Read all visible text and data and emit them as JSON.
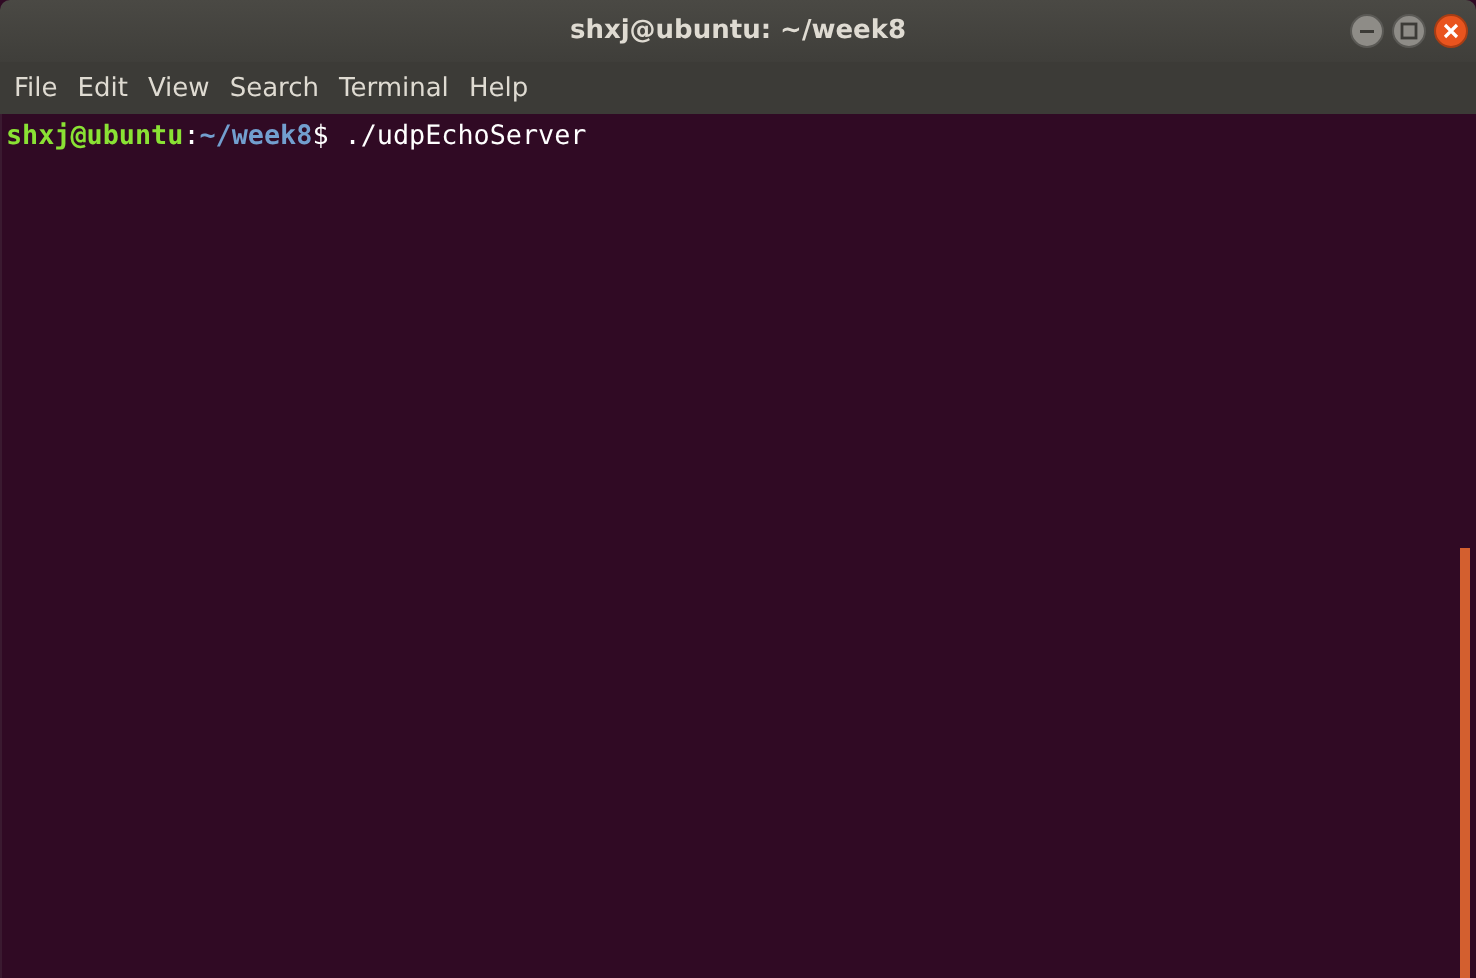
{
  "window": {
    "title": "shxj@ubuntu: ~/week8"
  },
  "menu": [
    {
      "label": "File"
    },
    {
      "label": "Edit"
    },
    {
      "label": "View"
    },
    {
      "label": "Search"
    },
    {
      "label": "Terminal"
    },
    {
      "label": "Help"
    }
  ],
  "terminal": {
    "lines": [
      {
        "user_host": "shxj@ubuntu",
        "separator": ":",
        "path": "~/week8",
        "symbol": "$",
        "command": " ./udpEchoServer"
      }
    ]
  }
}
